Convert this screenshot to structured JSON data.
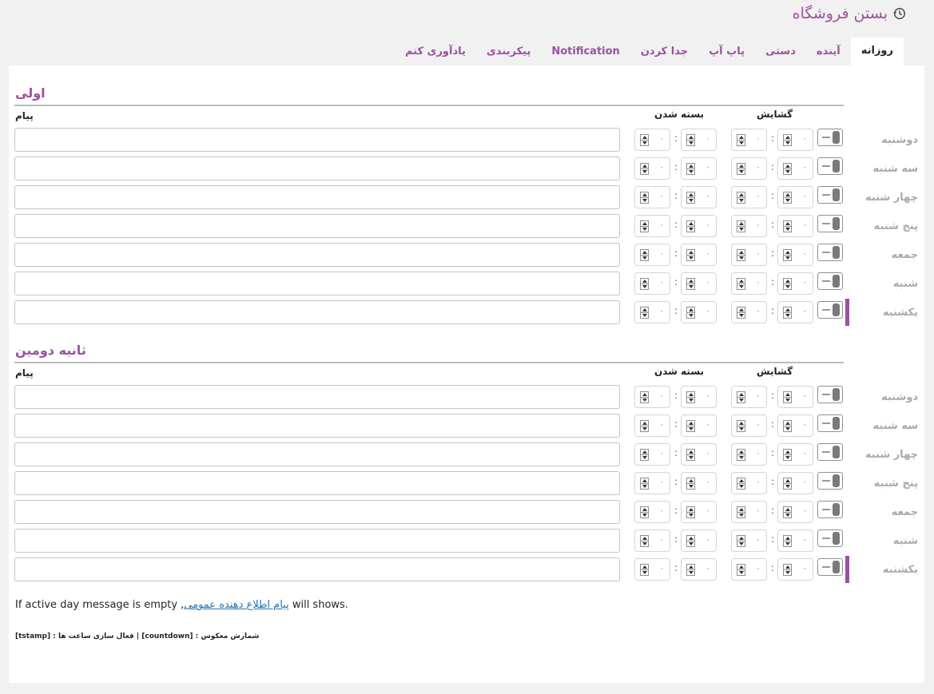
{
  "page": {
    "title": "بستن فروشگاه",
    "title_icon": "history-clock-icon"
  },
  "tabs": [
    {
      "label": "روزانه",
      "active": true
    },
    {
      "label": "آینده",
      "active": false
    },
    {
      "label": "دستی",
      "active": false
    },
    {
      "label": "پاپ آپ",
      "active": false
    },
    {
      "label": "جدا کردن",
      "active": false
    },
    {
      "label": "Notification",
      "active": false
    },
    {
      "label": "پیکربندی",
      "active": false
    },
    {
      "label": "یادآوری کنم",
      "active": false
    }
  ],
  "columns": {
    "opening": "گشایش",
    "closing": "بسته شدن",
    "message": "پیام"
  },
  "sections": [
    {
      "title": "اولی",
      "days": [
        {
          "label": "دوشنبه",
          "open_hour": "۰",
          "open_min": "۰",
          "close_hour": "۰",
          "close_min": "۰",
          "message": "",
          "highlighted": false
        },
        {
          "label": "سه شنبه",
          "open_hour": "۰",
          "open_min": "۰",
          "close_hour": "۰",
          "close_min": "۰",
          "message": "",
          "highlighted": false
        },
        {
          "label": "چهار شنبه",
          "open_hour": "۰",
          "open_min": "۰",
          "close_hour": "۰",
          "close_min": "۰",
          "message": "",
          "highlighted": false
        },
        {
          "label": "پنج شنبه",
          "open_hour": "۰",
          "open_min": "۰",
          "close_hour": "۰",
          "close_min": "۰",
          "message": "",
          "highlighted": false
        },
        {
          "label": "جمعه",
          "open_hour": "۰",
          "open_min": "۰",
          "close_hour": "۰",
          "close_min": "۰",
          "message": "",
          "highlighted": false
        },
        {
          "label": "شنبه",
          "open_hour": "۰",
          "open_min": "۰",
          "close_hour": "۰",
          "close_min": "۰",
          "message": "",
          "highlighted": false
        },
        {
          "label": "یکشنبه",
          "open_hour": "۰",
          "open_min": "۰",
          "close_hour": "۰",
          "close_min": "۰",
          "message": "",
          "highlighted": true
        }
      ]
    },
    {
      "title": "ثانیه دومین",
      "days": [
        {
          "label": "دوشنبه",
          "open_hour": "۰",
          "open_min": "۰",
          "close_hour": "۰",
          "close_min": "۰",
          "message": "",
          "highlighted": false
        },
        {
          "label": "سه شنبه",
          "open_hour": "۰",
          "open_min": "۰",
          "close_hour": "۰",
          "close_min": "۰",
          "message": "",
          "highlighted": false
        },
        {
          "label": "چهار شنبه",
          "open_hour": "۰",
          "open_min": "۰",
          "close_hour": "۰",
          "close_min": "۰",
          "message": "",
          "highlighted": false
        },
        {
          "label": "پنج شنبه",
          "open_hour": "۰",
          "open_min": "۰",
          "close_hour": "۰",
          "close_min": "۰",
          "message": "",
          "highlighted": false
        },
        {
          "label": "جمعه",
          "open_hour": "۰",
          "open_min": "۰",
          "close_hour": "۰",
          "close_min": "۰",
          "message": "",
          "highlighted": false
        },
        {
          "label": "شنبه",
          "open_hour": "۰",
          "open_min": "۰",
          "close_hour": "۰",
          "close_min": "۰",
          "message": "",
          "highlighted": false
        },
        {
          "label": "یکشنبه",
          "open_hour": "۰",
          "open_min": "۰",
          "close_hour": "۰",
          "close_min": "۰",
          "message": "",
          "highlighted": true
        }
      ]
    }
  ],
  "note": {
    "prefix": "If active day message is empty ,",
    "link": "پیام اطلاع دهنده عمومی",
    "suffix": " will shows."
  },
  "shortcodes": "[tstamp] : فعال سازی ساعت ها | [countdown] : شمارش معکوس",
  "colors": {
    "accent": "#9b51a0",
    "link": "#2271b1",
    "background": "#f1f1f1"
  }
}
